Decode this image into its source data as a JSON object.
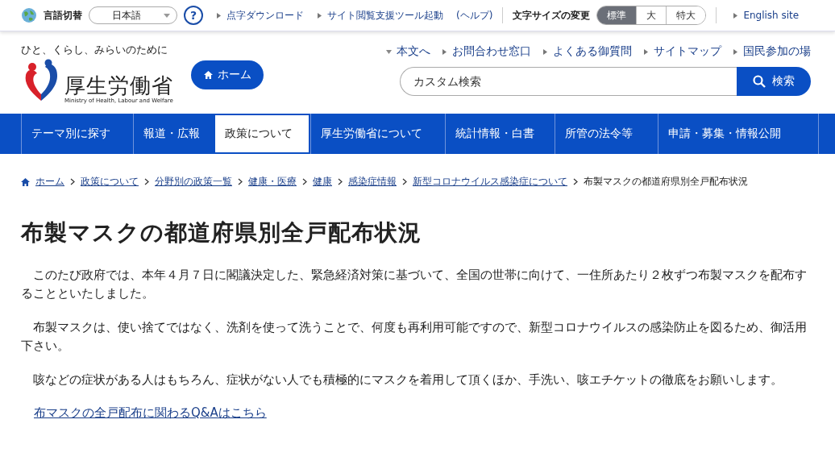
{
  "utility_bar": {
    "language_label": "言語切替",
    "language_select": {
      "value": "日本語"
    },
    "help_button": "?",
    "links": [
      "点字ダウンロード",
      "サイト閲覧支援ツール起動"
    ],
    "help_note": "(ヘルプ)",
    "text_size_label": "文字サイズの変更",
    "text_sizes": [
      {
        "label": "標準",
        "selected": true
      },
      {
        "label": "大",
        "selected": false
      },
      {
        "label": "特大",
        "selected": false
      }
    ],
    "english_link": "English site"
  },
  "header": {
    "tagline": "ひと、くらし、みらいのために",
    "logo_name": "厚生労働省",
    "logo_sub": "Ministry of Health, Labour and Welfare",
    "home_button": "ホーム",
    "links": [
      "本文へ",
      "お問合わせ窓口",
      "よくある御質問",
      "サイトマップ",
      "国民参加の場"
    ],
    "search": {
      "placeholder": "カスタム検索",
      "button": "検索"
    }
  },
  "nav": [
    {
      "label": "テーマ別に探す",
      "selected": false
    },
    {
      "label": "報道・広報",
      "selected": false
    },
    {
      "label": "政策について",
      "selected": true
    },
    {
      "label": "厚生労働省について",
      "selected": false
    },
    {
      "label": "統計情報・白書",
      "selected": false
    },
    {
      "label": "所管の法令等",
      "selected": false
    },
    {
      "label": "申請・募集・情報公開",
      "selected": false
    }
  ],
  "breadcrumb": {
    "links": [
      "ホーム",
      "政策について",
      "分野別の政策一覧",
      "健康・医療",
      "健康",
      "感染症情報",
      "新型コロナウイルス感染症について"
    ],
    "current": "布製マスクの都道府県別全戸配布状況"
  },
  "title": "布製マスクの都道府県別全戸配布状況",
  "paragraphs": [
    "　このたび政府では、本年４月７日に閣議決定した、緊急経済対策に基づいて、全国の世帯に向けて、一住所あたり２枚ずつ布製マスクを配布することといたしました。",
    "　布製マスクは、使い捨てではなく、洗剤を使って洗うことで、何度も再利用可能ですので、新型コロナウイルスの感染防止を図るため、御活用下さい。",
    "　咳などの症状がある人はもちろん、症状がない人でも積極的にマスクを着用して頂くほか、手洗い、咳エチケットの徹底をお願いします。"
  ],
  "faq_link": "布マスクの全戸配布に関わるQ&Aはこちら"
}
